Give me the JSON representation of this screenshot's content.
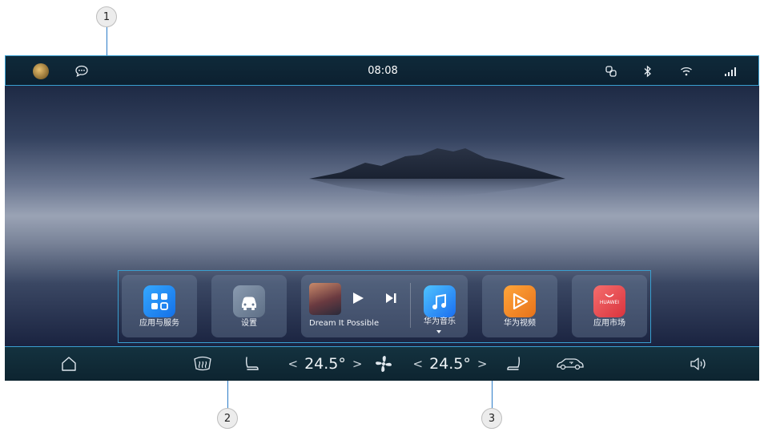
{
  "callouts": {
    "one": "1",
    "two": "2",
    "three": "3"
  },
  "status_bar": {
    "time": "08:08"
  },
  "icons": {
    "avatar": "avatar",
    "message": "message-icon",
    "link": "link-icon",
    "bluetooth": "bluetooth-icon",
    "wifi": "wifi-icon",
    "signal": "signal-icon"
  },
  "cards": {
    "apps_services": "应用与服务",
    "settings": "设置",
    "music_song": "Dream It Possible",
    "huawei_music": "华为音乐",
    "huawei_video": "华为视频",
    "app_market": "应用市场",
    "app_market_badge": "HUAWEI"
  },
  "dock": {
    "left_temp": "24.5°",
    "right_temp": "24.5°",
    "arrow_left": "<",
    "arrow_right": ">"
  },
  "colors": {
    "accent_line": "#3a9fd0",
    "apps_icon": "#1e90f5",
    "music_icon": "#2a8bf2",
    "video_icon": "#f08a24",
    "market_icon": "#e8434f"
  }
}
